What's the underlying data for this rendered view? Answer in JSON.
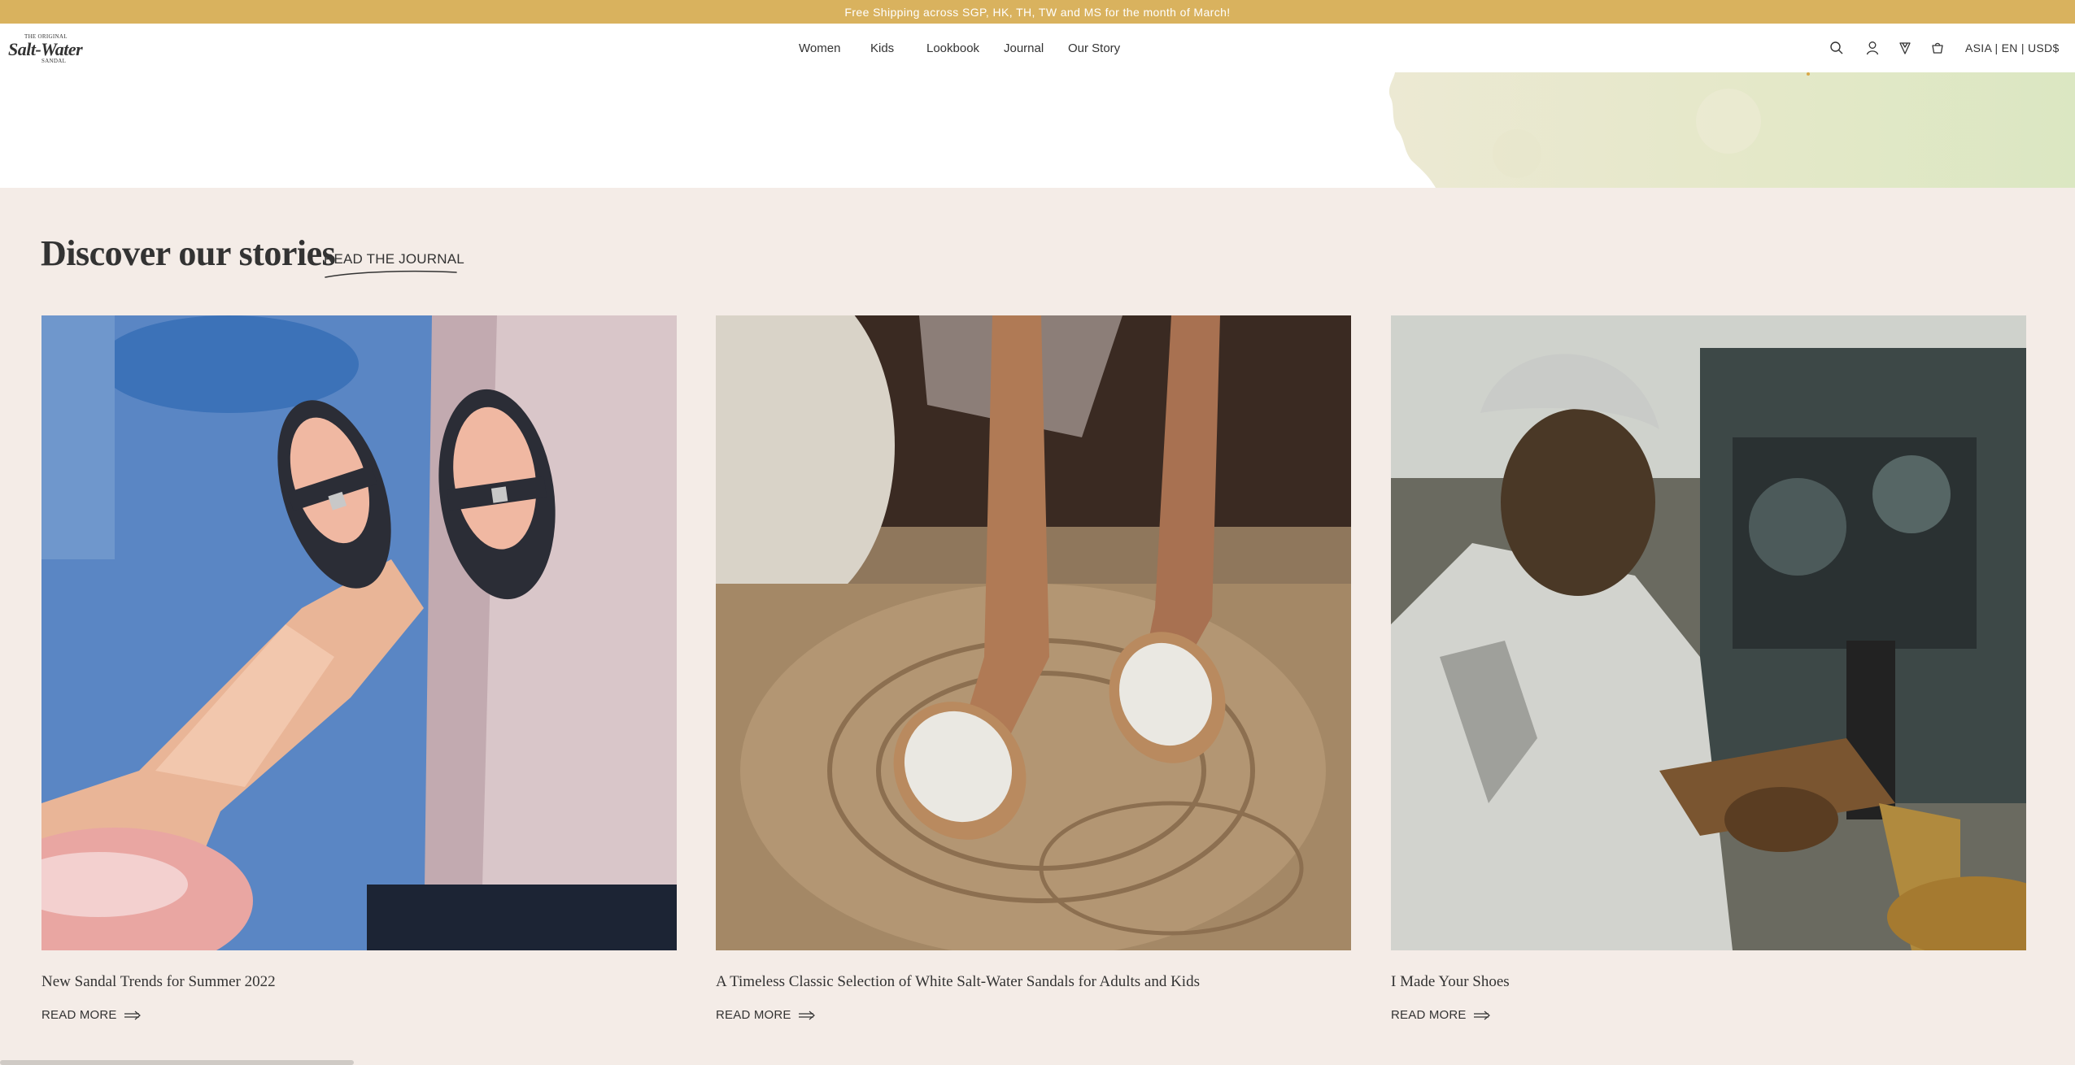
{
  "announcement": "Free Shipping across SGP, HK, TH, TW and MS for the month of March!",
  "logo": {
    "top": "THE ORIGINAL",
    "main": "Salt-Water",
    "bottom": "SANDAL"
  },
  "nav": [
    "Women",
    "Kids",
    "Lookbook",
    "Journal",
    "Our Story"
  ],
  "header_icons": [
    "search-icon",
    "account-icon",
    "wishlist-icon",
    "cart-icon"
  ],
  "region": "ASIA | EN | USD$",
  "section": {
    "title": "Discover our stories",
    "link": "READ THE JOURNAL"
  },
  "cards": [
    {
      "title": "New Sandal Trends for Summer 2022",
      "cta": "READ MORE"
    },
    {
      "title": "A Timeless Classic Selection of White Salt-Water Sandals for Adults and Kids",
      "cta": "READ MORE"
    },
    {
      "title": "I Made Your Shoes",
      "cta": "READ MORE"
    }
  ],
  "colors": {
    "announcement_bg": "#d9b25e",
    "section_bg": "#f4ece7",
    "text": "#333333"
  }
}
